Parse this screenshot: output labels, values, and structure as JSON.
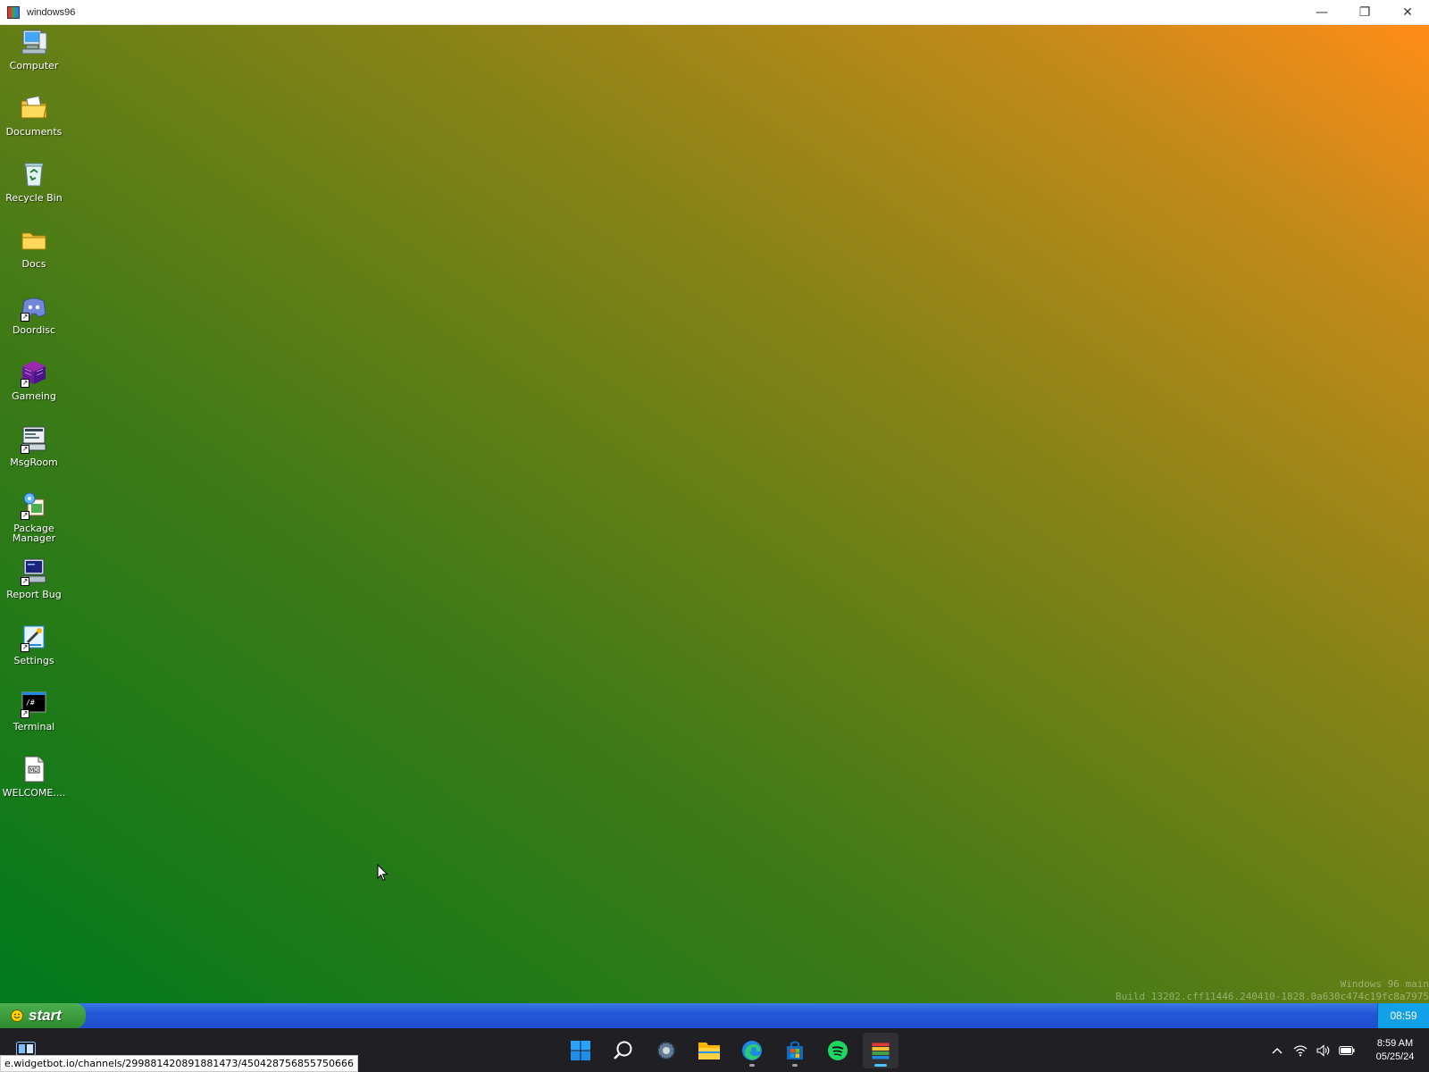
{
  "window": {
    "title": "windows96",
    "minimize": "—",
    "restore": "❐",
    "close": "✕"
  },
  "desktop_icons": [
    {
      "id": "computer",
      "label": "Computer",
      "icon": "computer-icon",
      "shortcut": false
    },
    {
      "id": "documents",
      "label": "Documents",
      "icon": "documents-folder-icon",
      "shortcut": false
    },
    {
      "id": "recycle-bin",
      "label": "Recycle Bin",
      "icon": "recycle-bin-icon",
      "shortcut": false
    },
    {
      "id": "docs",
      "label": "Docs",
      "icon": "folder-icon",
      "shortcut": false
    },
    {
      "id": "doordisc",
      "label": "Doordisc",
      "icon": "discord-icon",
      "shortcut": true
    },
    {
      "id": "gameing",
      "label": "Gameing",
      "icon": "cube-icon",
      "shortcut": true
    },
    {
      "id": "msgroom",
      "label": "MsgRoom",
      "icon": "msgroom-icon",
      "shortcut": true
    },
    {
      "id": "package-manager",
      "label": "Package Manager",
      "icon": "package-manager-icon",
      "shortcut": true
    },
    {
      "id": "report-bug",
      "label": "Report Bug",
      "icon": "report-bug-icon",
      "shortcut": true
    },
    {
      "id": "settings",
      "label": "Settings",
      "icon": "settings-icon",
      "shortcut": true
    },
    {
      "id": "terminal",
      "label": "Terminal",
      "icon": "terminal-icon",
      "shortcut": true
    },
    {
      "id": "welcome",
      "label": "WELCOME....",
      "icon": "text-file-icon",
      "shortcut": false
    }
  ],
  "watermark": {
    "line1": "Windows 96 main",
    "line2": "Build 13202.cff11446.240410-1828.0a630c474c19fc8a7975"
  },
  "w96_taskbar": {
    "start_label": "start",
    "clock": "08:59"
  },
  "host_taskbar": {
    "apps": [
      {
        "name": "start-windows-icon",
        "active": false,
        "running": false
      },
      {
        "name": "search-icon",
        "active": false,
        "running": false
      },
      {
        "name": "settings-gear-icon",
        "active": false,
        "running": false
      },
      {
        "name": "file-explorer-icon",
        "active": false,
        "running": false
      },
      {
        "name": "edge-icon",
        "active": false,
        "running": true
      },
      {
        "name": "store-icon",
        "active": false,
        "running": true
      },
      {
        "name": "spotify-icon",
        "active": false,
        "running": false
      },
      {
        "name": "windows96-app-icon",
        "active": true,
        "running": true
      }
    ],
    "time": "8:59 AM",
    "date": "05/25/24"
  },
  "status_url": "e.widgetbot.io/channels/299881420891881473/450428756855750666",
  "colors": {
    "w96_taskbar": "#2357d8",
    "start_button": "#3a9c3a",
    "w96_clock": "#12a1e8",
    "accent": "#4cc2ff"
  }
}
